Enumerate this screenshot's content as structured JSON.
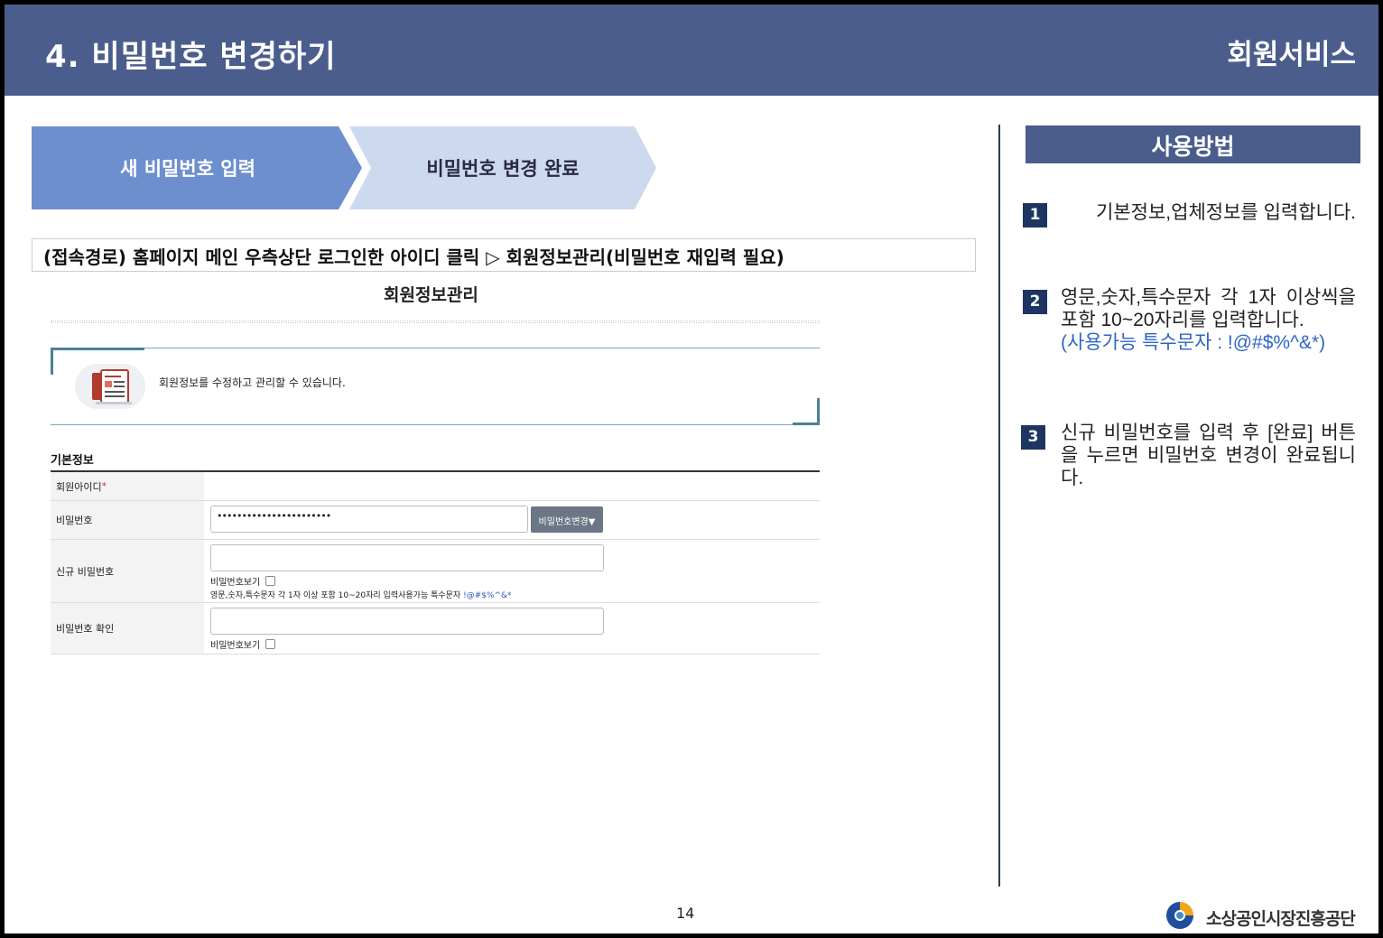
{
  "header": {
    "title": "4. 비밀번호 변경하기",
    "category": "회원서비스"
  },
  "steps": [
    "새 비밀번호 입력",
    "비밀번호 변경 완료"
  ],
  "access_path": "(접속경로) 홈페이지 메인 우측상단 로그인한 아이디 클릭 ▷ 회원정보관리(비밀번호 재입력 필요)",
  "screenshot": {
    "title": "회원정보관리",
    "intro_text": "회원정보를 수정하고 관리할 수 있습니다.",
    "section_title": "기본정보",
    "rows": {
      "member_id": {
        "label": "회원아이디",
        "required_mark": "*"
      },
      "password": {
        "label": "비밀번호",
        "masked_value": "•••••••••••••••••••••••",
        "button": "비밀번호변경▼"
      },
      "new_password": {
        "label": "신규 비밀번호",
        "show_label": "비밀번호보기",
        "hint": "영문,숫자,특수문자 각 1자 이상 포함 10~20자리 입력사용가능 특수문자 ",
        "hint_chars": "!@#$%^&*"
      },
      "confirm_password": {
        "label": "비밀번호 확인",
        "show_label": "비밀번호보기"
      }
    }
  },
  "guide": {
    "title": "사용방법",
    "items": [
      {
        "num": "1",
        "text": "기본정보,업체정보를 입력합니다."
      },
      {
        "num": "2",
        "text": "영문,숫자,특수문자 각 1자 이상씩을 포함 10~20자리를 입력합니다.",
        "note": "(사용가능 특수문자 : !@#$%^&*)"
      },
      {
        "num": "3",
        "text": "신규 비밀번호를 입력 후 [완료] 버튼을 누르면 비밀번호 변경이 완료됩니다."
      }
    ]
  },
  "footer": {
    "page_number": "14",
    "org_name": "소상공인시장진흥공단"
  },
  "colors": {
    "header": "#4b5d8c",
    "step_active": "#6d8fce",
    "step_inactive": "#cdd9ef",
    "badge": "#1f3561",
    "note_blue": "#2e66c4"
  }
}
